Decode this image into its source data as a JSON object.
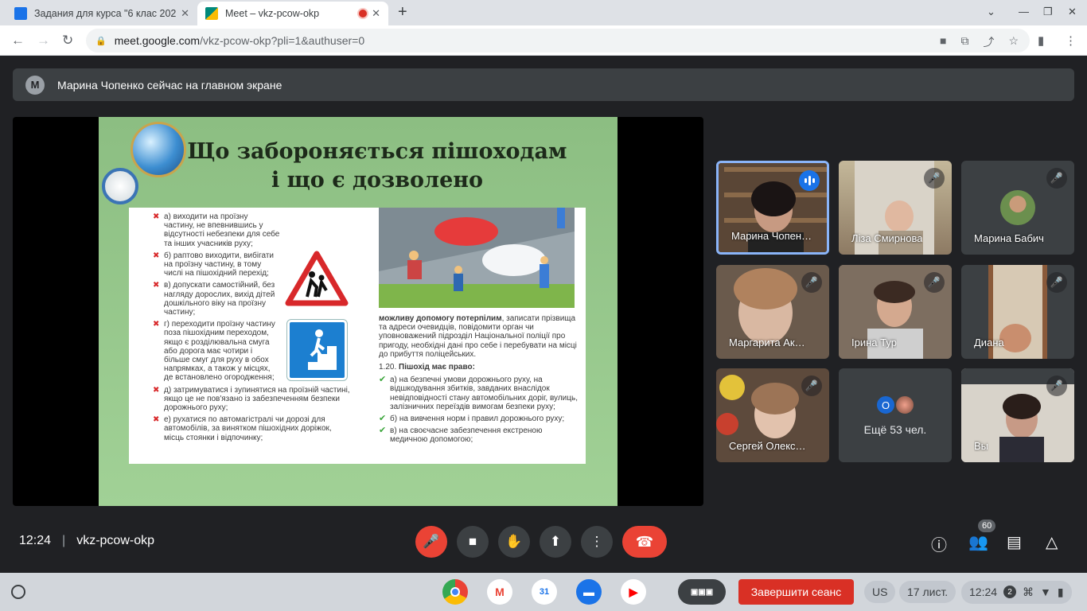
{
  "browser": {
    "tabs": [
      {
        "title": "Задания для курса \"6 клас 202",
        "favicon_color": "#1a73e8"
      },
      {
        "title": "Meet – vkz-pcow-okp",
        "favicon_color": "#00897b",
        "recording": true
      }
    ],
    "new_tab": "+",
    "url_host": "meet.google.com",
    "url_path": "/vkz-pcow-okp?pli=1&authuser=0"
  },
  "banner": {
    "avatar_letter": "M",
    "text": "Марина Чопенко сейчас на главном экране"
  },
  "slide": {
    "title": "Що забороняється пішоходам і що є дозволено",
    "prohibitions": [
      "а) виходити на проїзну частину, не впевнившись у відсутності небезпеки для себе та інших учасників руху;",
      "б) раптово виходити, вибігати на проїзну частину, в тому числі на пішохідний перехід;",
      "в) допускати самостійний, без нагляду дорослих, вихід дітей дошкільного віку на проїзну частину;",
      "г) переходити проїзну частину поза пішохідним переходом, якщо є розділювальна смуга або дорога має чотири і більше смуг для руху в обох напрямках, а також у місцях, де встановлено огородження;",
      "д) затримуватися і зупинятися на проїзній частині, якщо це не пов'язано із забезпеченням безпеки дорожнього руху;",
      "е) рухатися по автомагістралі чи дорозі для автомобілів, за винятком пішохідних доріжок, місць стоянки і відпочинку;"
    ],
    "help_text_bold": "можливу допомогу потерпілим",
    "help_text_rest": ", записати прізвища та адреси очевидців, повідомити орган чи уповноважений підрозділ Національної поліції про пригоду, необхідні дані про себе і перебувати на місці до прибуття поліцейських.",
    "rights_number": "1.20.",
    "rights_heading": "Пішохід має право:",
    "rights": [
      "а) на безпечні умови дорожнього руху, на відшкодування збитків, завданих внаслідок невідповідності стану автомобільних доріг, вулиць, залізничних переїздів вимогам безпеки руху;",
      "б) на вивчення норм і правил дорожнього руху;",
      "в) на своєчасне забезпечення екстреною медичною допомогою;"
    ]
  },
  "participants": [
    {
      "name": "Марина Чопенко",
      "display": "Марина Чопен…",
      "speaking": true
    },
    {
      "name": "Ліза Смирнова",
      "display": "Ліза Смирнова",
      "muted": true
    },
    {
      "name": "Марина Бабич",
      "display": "Марина Бабич",
      "muted": true
    },
    {
      "name": "Маргарита Ак…",
      "display": "Маргарита Ак…",
      "muted": true
    },
    {
      "name": "Ірина Тур",
      "display": "Ірина Тур",
      "muted": true
    },
    {
      "name": "Диана",
      "display": "Диана",
      "muted": true
    },
    {
      "name": "Сергей Олекс…",
      "display": "Сергей Олекс…",
      "muted": true
    },
    {
      "name": "Вы",
      "display": "Вы",
      "muted": true
    }
  ],
  "more_tile": {
    "chip_letter": "O",
    "text": "Ещё 53 чел."
  },
  "bottom": {
    "time": "12:24",
    "separator": "|",
    "meeting_code": "vkz-pcow-okp",
    "people_count": "60"
  },
  "shelf": {
    "end_session": "Завершити сеанс",
    "layout": "US",
    "date": "17 лист.",
    "time": "12:24",
    "notifications": "2"
  }
}
